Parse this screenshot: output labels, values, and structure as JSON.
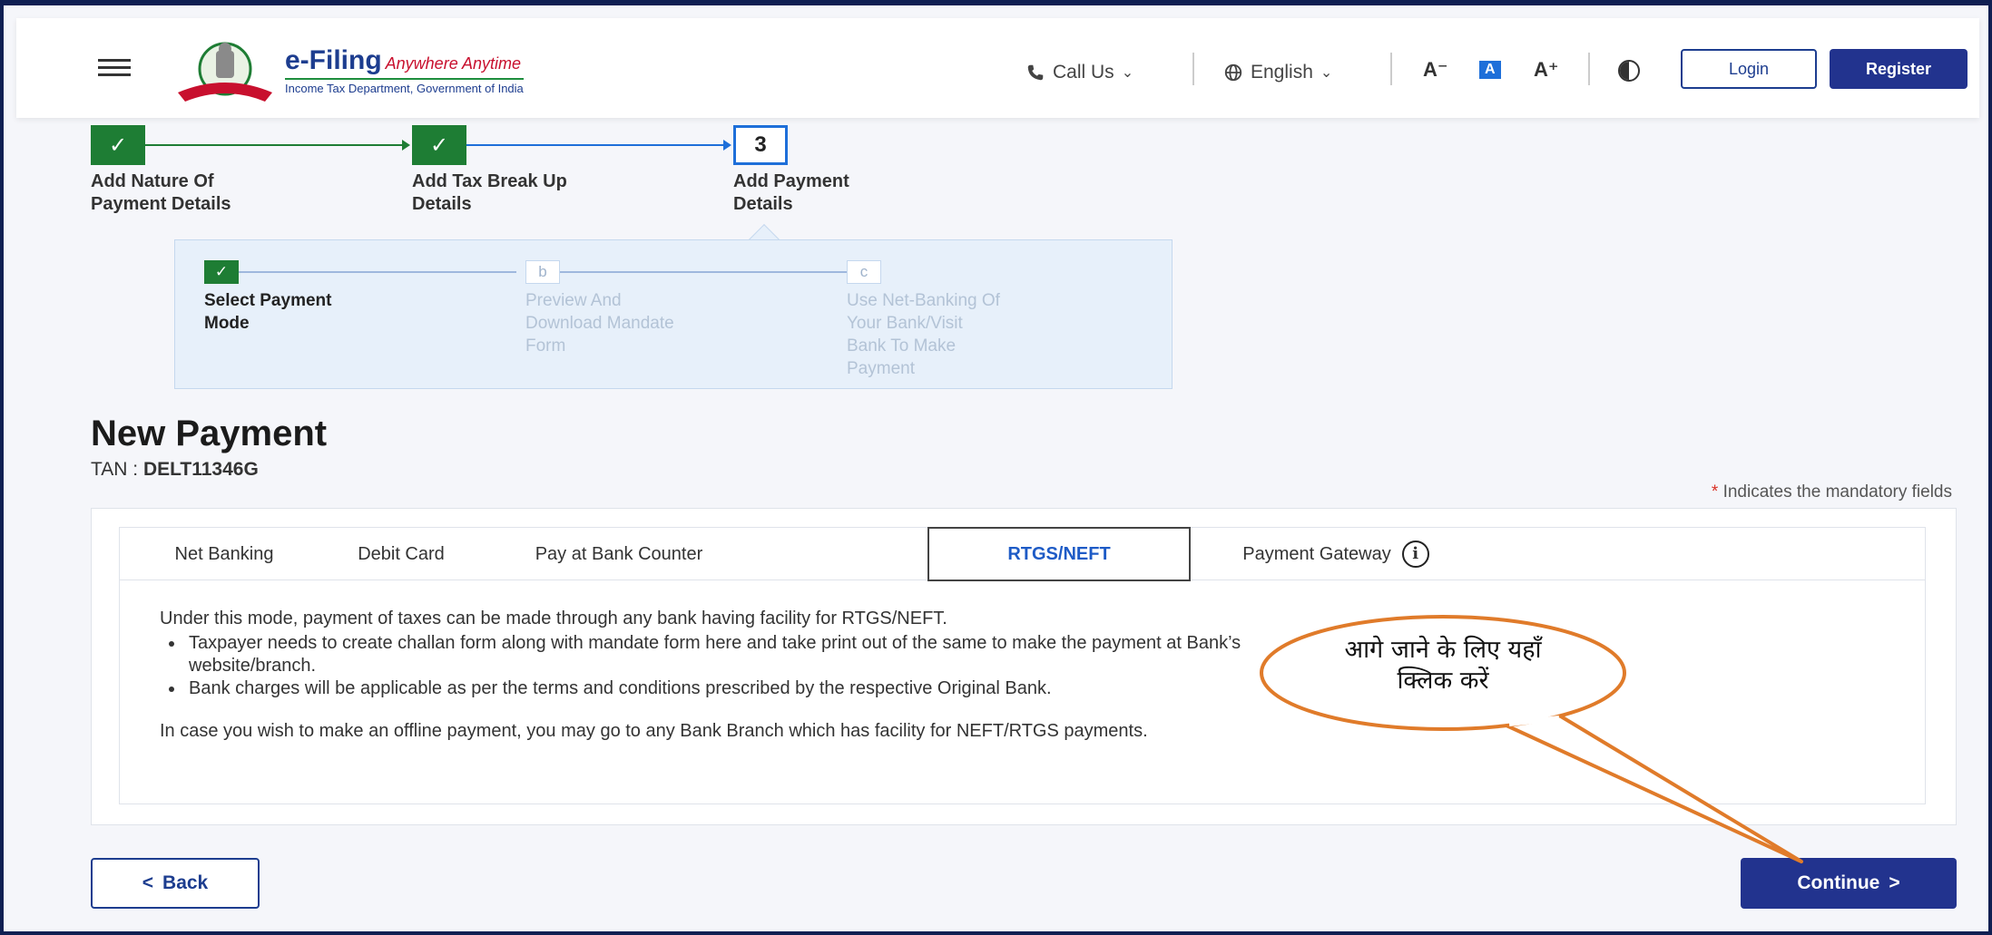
{
  "header": {
    "logo_title": "e-Filing",
    "logo_tagline": "Anywhere Anytime",
    "logo_subtitle": "Income Tax Department, Government of India",
    "call_us": "Call Us",
    "language": "English",
    "font_decrease": "A⁻",
    "font_normal": "A",
    "font_increase": "A⁺",
    "login_label": "Login",
    "register_label": "Register"
  },
  "stepper": {
    "steps": [
      {
        "marker": "✓",
        "label_line1": "Add Nature Of",
        "label_line2": "Payment Details",
        "status": "done"
      },
      {
        "marker": "✓",
        "label_line1": "Add Tax Break Up",
        "label_line2": "Details",
        "status": "done"
      },
      {
        "marker": "3",
        "label_line1": "Add Payment",
        "label_line2": "Details",
        "status": "current"
      }
    ],
    "substeps": [
      {
        "marker": "✓",
        "label": [
          "Select Payment",
          "Mode"
        ],
        "status": "done"
      },
      {
        "marker": "b",
        "label": [
          "Preview And",
          "Download Mandate",
          "Form"
        ],
        "status": "pending"
      },
      {
        "marker": "c",
        "label": [
          "Use Net-Banking Of",
          "Your Bank/Visit",
          "Bank To Make",
          "Payment"
        ],
        "status": "pending"
      }
    ]
  },
  "page": {
    "title": "New Payment",
    "tan_label": "TAN : ",
    "tan_value": "DELT11346G",
    "mandatory_star": "*",
    "mandatory_note": " Indicates the mandatory fields"
  },
  "tabs": [
    {
      "label": "Net Banking",
      "active": false
    },
    {
      "label": "Debit Card",
      "active": false
    },
    {
      "label": "Pay at Bank Counter",
      "active": false
    },
    {
      "label": "RTGS/NEFT",
      "active": true
    },
    {
      "label": "Payment Gateway",
      "active": false
    }
  ],
  "content": {
    "intro": "Under this mode, payment of taxes can be made through any bank having facility for RTGS/NEFT.",
    "bullets": [
      "Taxpayer needs to create challan form along with mandate form here and take print out of the same to make the payment at Bank’s website/branch.",
      "Bank charges will be applicable as per the terms and conditions prescribed by the respective Original Bank."
    ],
    "offline": "In case you wish to make an offline payment, you may go to any Bank Branch which has facility for NEFT/RTGS payments."
  },
  "actions": {
    "back_label": "Back",
    "back_chevron": "<",
    "continue_label": "Continue",
    "continue_chevron": ">"
  },
  "callout": {
    "line1": "आगे जाने के लिए यहाँ",
    "line2": "क्लिक करें"
  },
  "colors": {
    "primary": "#22338e",
    "done_green": "#1e7d34",
    "active_blue": "#1e6fd9",
    "callout_orange": "#e07b2a"
  }
}
